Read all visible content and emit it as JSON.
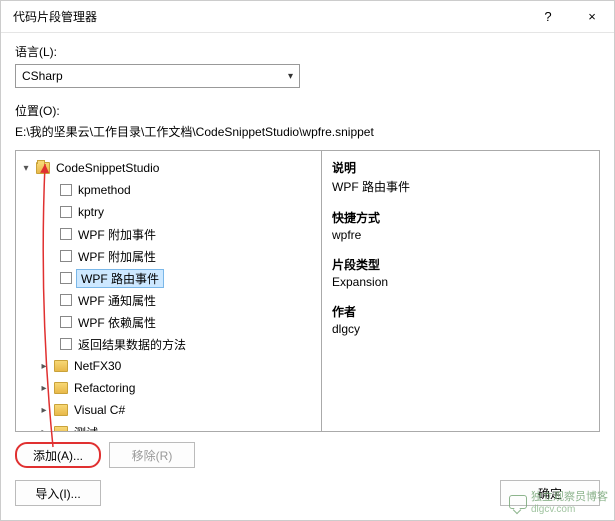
{
  "titlebar": {
    "title": "代码片段管理器",
    "help": "?",
    "close": "×"
  },
  "language_label": "语言(L):",
  "language_value": "CSharp",
  "location_label": "位置(O):",
  "location_path": "E:\\我的坚果云\\工作目录\\工作文档\\CodeSnippetStudio\\wpfre.snippet",
  "tree": {
    "root": "CodeSnippetStudio",
    "children": [
      "kpmethod",
      "kptry",
      "WPF 附加事件",
      "WPF 附加属性",
      "WPF 路由事件",
      "WPF 通知属性",
      "WPF 依赖属性",
      "返回结果数据的方法"
    ],
    "folders": [
      "NetFX30",
      "Refactoring",
      "Visual C#",
      "测试"
    ]
  },
  "detail": {
    "desc_label": "说明",
    "desc_value": "WPF 路由事件",
    "shortcut_label": "快捷方式",
    "shortcut_value": "wpfre",
    "type_label": "片段类型",
    "type_value": "Expansion",
    "author_label": "作者",
    "author_value": "dlgcy"
  },
  "buttons": {
    "add": "添加(A)...",
    "remove": "移除(R)",
    "import": "导入(I)...",
    "ok": "确定"
  },
  "watermark": {
    "name": "独立观察员博客",
    "domain": "dlgcv.com"
  }
}
